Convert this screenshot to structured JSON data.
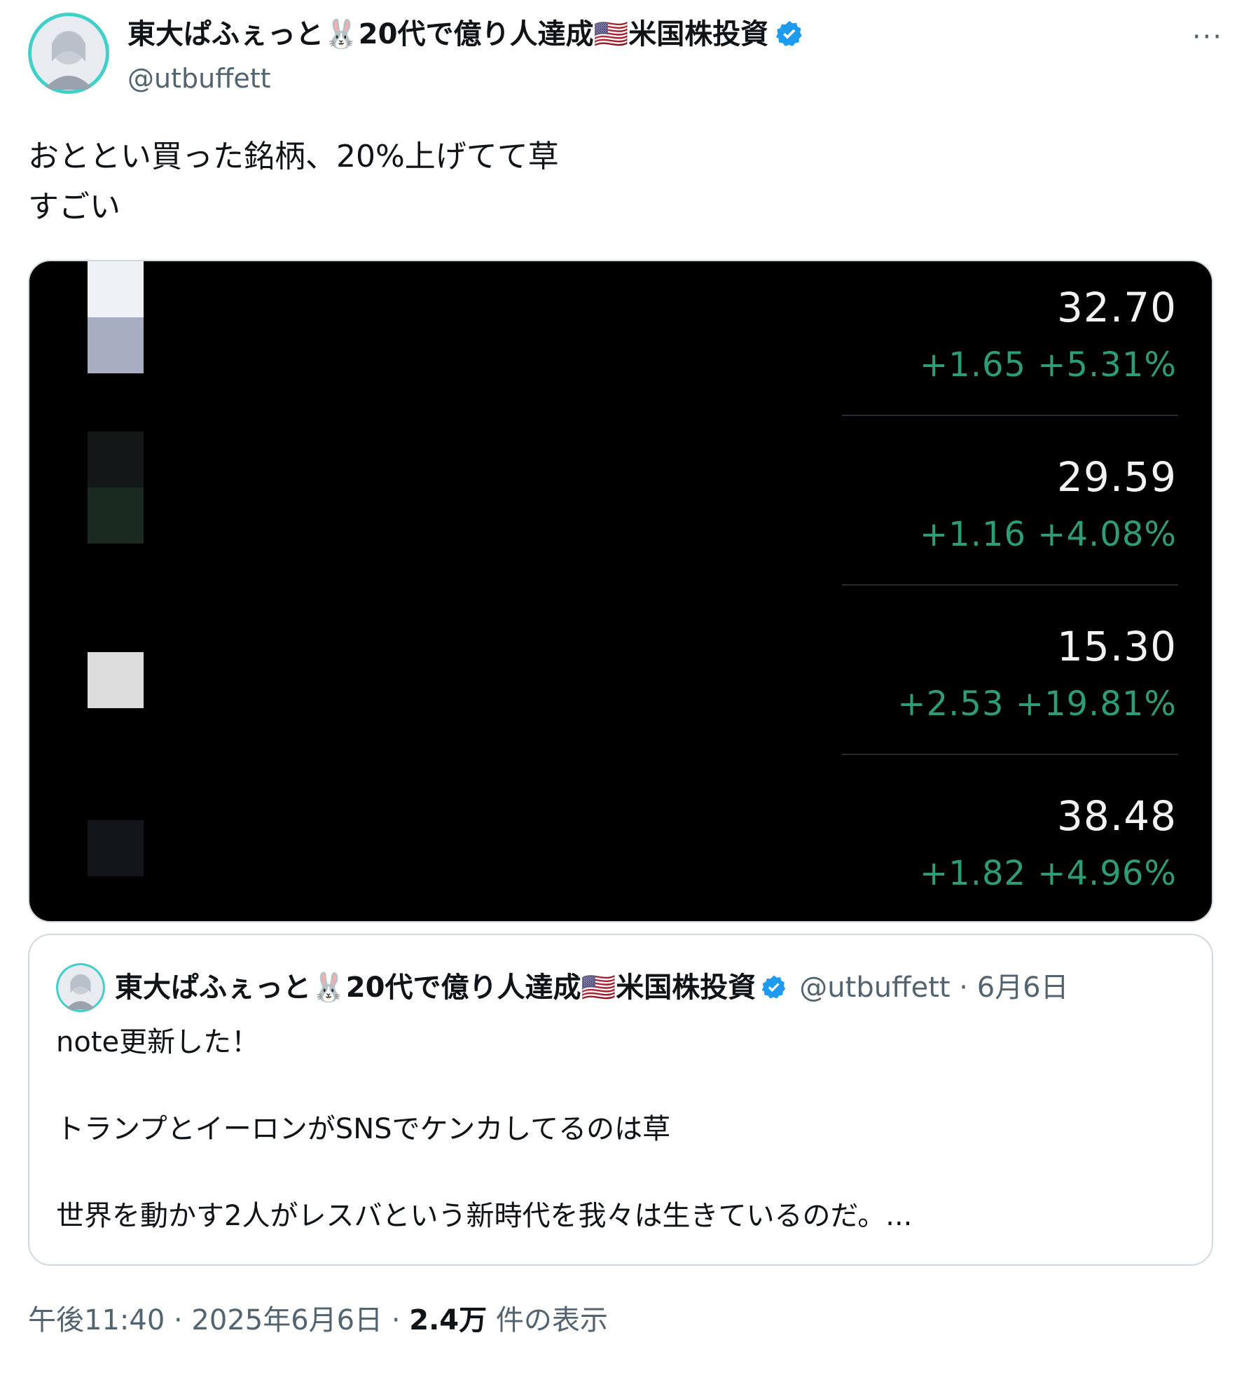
{
  "author": {
    "display_name": "東大ぱふぇっと🐰20代で億り人達成🇺🇸米国株投資",
    "handle": "@utbuffett",
    "verified_icon": "verified-badge-icon",
    "avatar_icon": "avatar"
  },
  "menu": {
    "more_label": "···"
  },
  "tweet": {
    "text": "おととい買った銘柄、20%上げてて草\nすごい"
  },
  "media": {
    "rows": [
      {
        "price": "32.70",
        "change": "+1.65 +5.31%",
        "icon_top": "#eef1f6",
        "icon_bottom": "#a8aec2"
      },
      {
        "price": "29.59",
        "change": "+1.16 +4.08%",
        "icon_top": "#141718",
        "icon_bottom": "#1a2a20"
      },
      {
        "price": "15.30",
        "change": "+2.53 +19.81%",
        "icon_top": "#dcdcdc",
        "icon_bottom": "#dcdcdc"
      },
      {
        "price": "38.48",
        "change": "+1.82 +4.96%",
        "icon_top": "#12161a",
        "icon_bottom": "#12161a"
      }
    ],
    "up_color": "#2e9c74"
  },
  "quote": {
    "display_name": "東大ぱふぇっと🐰20代で億り人達成🇺🇸米国株投資",
    "meta": "@utbuffett · 6月6日",
    "text": "note更新した！\n\nトランプとイーロンがSNSでケンカしてるのは草\n\n世界を動かす2人がレスバという新時代を我々は生きているのだ。..."
  },
  "footer": {
    "time_date": "午後11:40 · 2025年6月6日 · ",
    "views_count": "2.4万",
    "views_label": " 件の表示"
  },
  "colors": {
    "link_blue": "#1d9bf0",
    "muted": "#536471"
  }
}
